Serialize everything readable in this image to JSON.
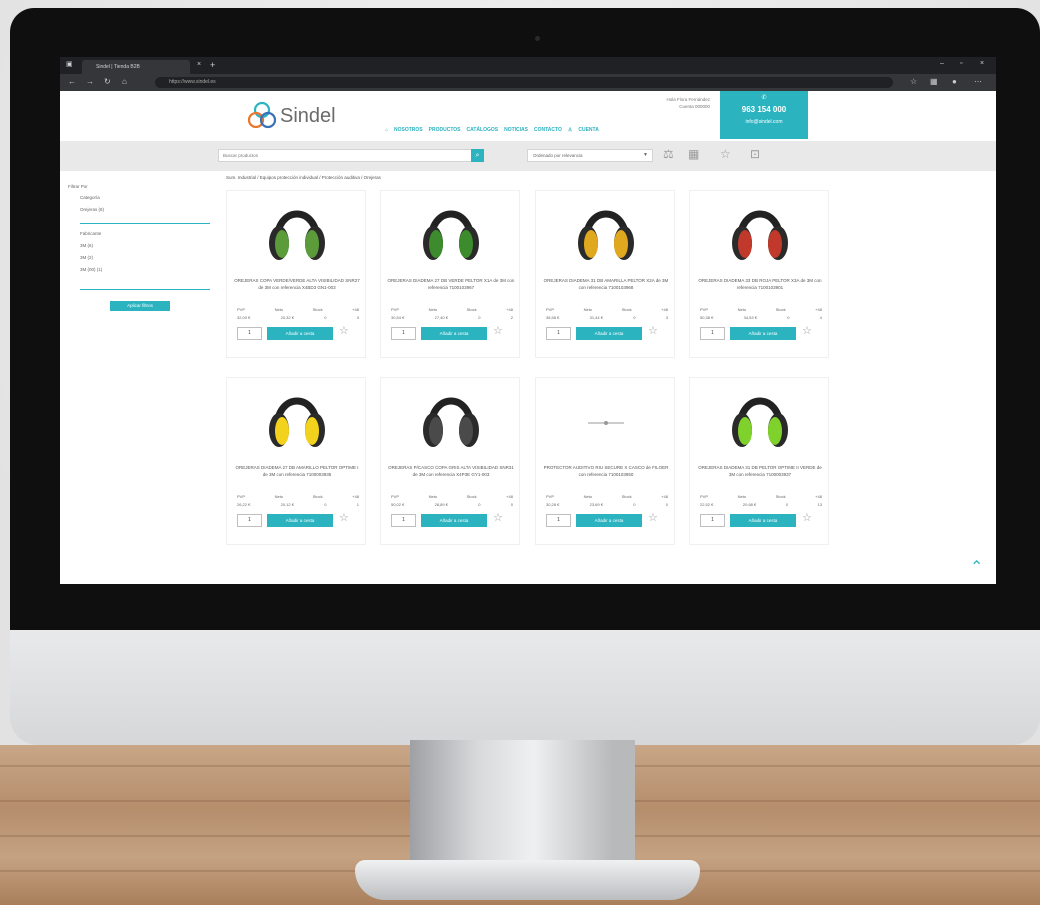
{
  "browser": {
    "tab_title": "Sindel | Tienda B2B",
    "url": "https://www.sindel.es"
  },
  "header": {
    "logo_text": "Sindel",
    "user_name": "Hola Flora Fernández",
    "user_account": "Cuenta 000000",
    "nav": [
      "NOSOTROS",
      "PRODUCTOS",
      "CATÁLOGOS",
      "NOTICIAS",
      "CONTACTO",
      "CUENTA"
    ],
    "phone": "963 154 000",
    "email": "info@sindel.com"
  },
  "toolbar": {
    "search_placeholder": "Buscar productos",
    "sort_label": "Ordenado por relevancia"
  },
  "breadcrumb": "Sum. Industrial / Equipos protección individual / Protección auditiva / Orejeras",
  "filters": {
    "title": "Filtrar Por",
    "category_heading": "Categoría",
    "category_option": "Orejeras (8)",
    "brand_heading": "Fabricante",
    "brand_options": [
      "3M (6)",
      "3M (2)",
      "3M (00) (1)"
    ],
    "apply_label": "Aplicar filtros"
  },
  "price_headers": [
    "PVP",
    "Neto",
    "Stock",
    "+48"
  ],
  "quantity_default": "1",
  "add_label": "Añadir a cesta",
  "products": [
    {
      "title": "OREJERAS COPA VERDE/VERDE ALTA VISIBILIDAD SNR27 de 3M con referencia X4BD3 GN1-003",
      "pvp": "32,00 €",
      "neto": "20,32 €",
      "stock": "0",
      "plus48": "3",
      "color": "#5b9b3a"
    },
    {
      "title": "OREJERAS DIADEMA 27 DB VERDE PELTOR X1A de 3M con referencia 7100103967",
      "pvp": "30,54 €",
      "neto": "27,40 €",
      "stock": "0",
      "plus48": "2",
      "color": "#3c8b2c"
    },
    {
      "title": "OREJERAS DIADEMA 31 DB AMARILLA PELTOR X2A de 3M con referencia 7100103968",
      "pvp": "38,58 €",
      "neto": "31,44 €",
      "stock": "0",
      "plus48": "3",
      "color": "#e0a81e"
    },
    {
      "title": "OREJERAS DIADEMA 33 DB ROJA PELTOR X3A de 3M con referencia 7100103901",
      "pvp": "50,38 €",
      "neto": "34,53 €",
      "stock": "0",
      "plus48": "4",
      "color": "#c0392b"
    },
    {
      "title": "OREJERAS DIADEMA 27 DB AMARILLO PELTOR OPTIME I de 3M con referencia 7100003935",
      "pvp": "26,22 €",
      "neto": "20,12 €",
      "stock": "0",
      "plus48": "1",
      "color": "#f2d21c"
    },
    {
      "title": "OREJERAS P/CASCO COPA GRIS ALTA VISIBILIDAD SNR31 de 3M con referencia X4P3E GY1-003",
      "pvp": "50,02 €",
      "neto": "28,89 €",
      "stock": "0",
      "plus48": "0",
      "color": "#4a4a4a"
    },
    {
      "title": "PROTECTOR AUDITIVO RIU SECURE X CASCO de FILOER con referencia 7100103950",
      "pvp": "30,28 €",
      "neto": "23,69 €",
      "stock": "0",
      "plus48": "0",
      "color": "#cccccc"
    },
    {
      "title": "OREJERAS DIADEMA 31 DB PELTOR OPTIME II VERDE de 3M con referencia 7100003937",
      "pvp": "22,52 €",
      "neto": "20,68 €",
      "stock": "0",
      "plus48": "13",
      "color": "#7fd12b"
    }
  ]
}
